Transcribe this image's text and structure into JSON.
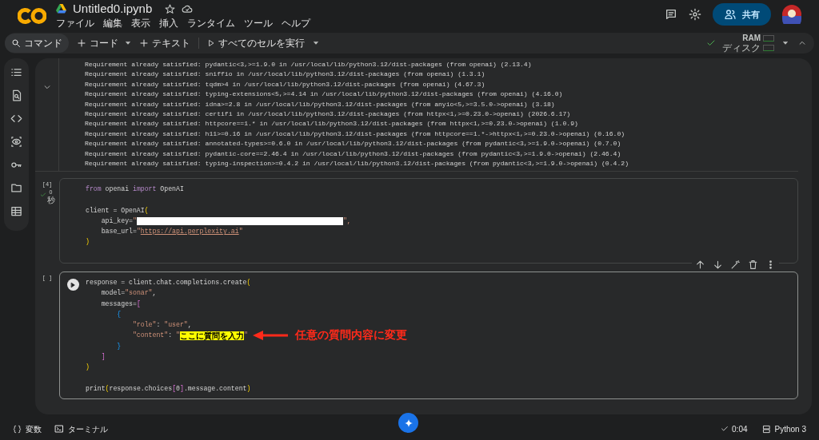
{
  "header": {
    "title": "Untitled0.ipynb",
    "menu": [
      "ファイル",
      "編集",
      "表示",
      "挿入",
      "ランタイム",
      "ツール",
      "ヘルプ"
    ],
    "share": "共有"
  },
  "toolbar": {
    "command": "コマンド",
    "add_code": "コード",
    "add_text": "テキスト",
    "run_all": "すべてのセルを実行",
    "ram": "RAM",
    "disk": "ディスク"
  },
  "output_cell": {
    "lines": [
      "Requirement already satisfied: pydantic<3,>=1.9.0 in /usr/local/lib/python3.12/dist-packages (from openai) (2.13.4)",
      "Requirement already satisfied: sniffio in /usr/local/lib/python3.12/dist-packages (from openai) (1.3.1)",
      "Requirement already satisfied: tqdm>4 in /usr/local/lib/python3.12/dist-packages (from openai) (4.67.3)",
      "Requirement already satisfied: typing-extensions<5,>=4.14 in /usr/local/lib/python3.12/dist-packages (from openai) (4.16.0)",
      "Requirement already satisfied: idna>=2.8 in /usr/local/lib/python3.12/dist-packages (from anyio<5,>=3.5.0->openai) (3.18)",
      "Requirement already satisfied: certifi in /usr/local/lib/python3.12/dist-packages (from httpx<1,>=0.23.0->openai) (2026.6.17)",
      "Requirement already satisfied: httpcore==1.* in /usr/local/lib/python3.12/dist-packages (from httpx<1,>=0.23.0->openai) (1.0.9)",
      "Requirement already satisfied: h11>=0.16 in /usr/local/lib/python3.12/dist-packages (from httpcore==1.*->httpx<1,>=0.23.0->openai) (0.16.0)",
      "Requirement already satisfied: annotated-types>=0.6.0 in /usr/local/lib/python3.12/dist-packages (from pydantic<3,>=1.9.0->openai) (0.7.0)",
      "Requirement already satisfied: pydantic-core==2.46.4 in /usr/local/lib/python3.12/dist-packages (from pydantic<3,>=1.9.0->openai) (2.46.4)",
      "Requirement already satisfied: typing-inspection>=0.4.2 in /usr/local/lib/python3.12/dist-packages (from pydantic<3,>=1.9.0->openai) (0.4.2)"
    ]
  },
  "cells": [
    {
      "exec_count": "[4]",
      "exec_time": "0",
      "exec_unit": "秒",
      "succeeded": true,
      "focused": false,
      "blocks": [
        [
          [
            {
              "text": "from",
              "kind": "kw"
            },
            {
              "text": " openai ",
              "kind": "plain"
            },
            {
              "text": "import",
              "kind": "kw"
            },
            {
              "text": " OpenAI",
              "kind": "plain"
            }
          ]
        ],
        [
          [
            {
              "text": "client = OpenAI",
              "kind": "plain"
            },
            {
              "text": "(",
              "kind": "b1"
            }
          ],
          [
            {
              "text": "    api_key=",
              "kind": "plain"
            },
            {
              "text": "\"",
              "kind": "str"
            },
            {
              "kind": "redacted"
            },
            {
              "text": "\",",
              "kind": "str"
            }
          ],
          [
            {
              "text": "    base_url=",
              "kind": "plain"
            },
            {
              "text": "\"",
              "kind": "str"
            },
            {
              "text": "https://api.perplexity.ai",
              "kind": "url"
            },
            {
              "text": "\"",
              "kind": "str"
            }
          ],
          [
            {
              "text": ")",
              "kind": "b1"
            }
          ]
        ]
      ]
    },
    {
      "exec_count": "[ ]",
      "succeeded": false,
      "focused": true,
      "blocks": [
        [
          [
            {
              "text": "response = client.chat.completions.create",
              "kind": "plain"
            },
            {
              "text": "(",
              "kind": "b1"
            }
          ],
          [
            {
              "text": "    model=",
              "kind": "plain"
            },
            {
              "text": "\"sonar\"",
              "kind": "str"
            },
            {
              "text": ",",
              "kind": "plain"
            }
          ],
          [
            {
              "text": "    messages=",
              "kind": "plain"
            },
            {
              "text": "[",
              "kind": "b2"
            }
          ],
          [
            {
              "text": "        {",
              "kind": "b3"
            }
          ],
          [
            {
              "text": "            \"role\"",
              "kind": "str"
            },
            {
              "text": ": ",
              "kind": "plain"
            },
            {
              "text": "\"user\"",
              "kind": "str"
            },
            {
              "text": ",",
              "kind": "plain"
            }
          ],
          [
            {
              "text": "            \"content\"",
              "kind": "str"
            },
            {
              "text": ": ",
              "kind": "plain"
            },
            {
              "text": "\"",
              "kind": "str"
            },
            {
              "text": "ここに質問を入力",
              "kind": "highlight"
            },
            {
              "text": "\"",
              "kind": "str"
            }
          ],
          [
            {
              "text": "        }",
              "kind": "b3"
            }
          ],
          [
            {
              "text": "    ]",
              "kind": "b2"
            }
          ],
          [
            {
              "text": ")",
              "kind": "b1"
            }
          ]
        ],
        [
          [
            {
              "text": "print",
              "kind": "plain"
            },
            {
              "text": "(",
              "kind": "b1"
            },
            {
              "text": "response.choices",
              "kind": "plain"
            },
            {
              "text": "[",
              "kind": "b2"
            },
            {
              "text": "0",
              "kind": "plain"
            },
            {
              "text": "]",
              "kind": "b2"
            },
            {
              "text": ".message.content",
              "kind": "plain"
            },
            {
              "text": ")",
              "kind": "b1"
            }
          ]
        ]
      ]
    }
  ],
  "annotation": "任意の質問内容に変更",
  "status_bar": {
    "variables": "変数",
    "terminal": "ターミナル",
    "elapsed": "0:04",
    "runtime": "Python 3"
  }
}
